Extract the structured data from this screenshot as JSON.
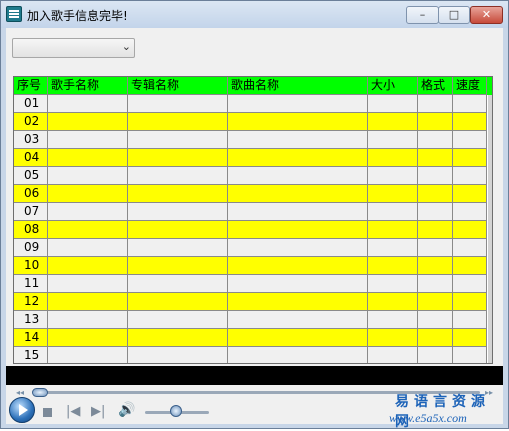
{
  "window": {
    "title": "加入歌手信息完毕!",
    "min_glyph": "–",
    "max_glyph": "□",
    "close_glyph": "✕"
  },
  "combo": {
    "value": "",
    "arrow": "⌄"
  },
  "table": {
    "columns": [
      "序号",
      "歌手名称",
      "专辑名称",
      "歌曲名称",
      "大小",
      "格式",
      "速度"
    ],
    "rows": [
      "01",
      "02",
      "03",
      "04",
      "05",
      "06",
      "07",
      "08",
      "09",
      "10",
      "11",
      "12",
      "13",
      "14",
      "15"
    ],
    "stripe_color": "#ffff00",
    "header_color": "#00ff00"
  },
  "player": {
    "seek_prev": "◂◂",
    "seek_next": "▸▸",
    "prev_glyph": "|◀",
    "next_glyph": "▶|",
    "volume_glyph": "🔊"
  },
  "watermark": {
    "cn": "易语言资源网",
    "url": "www.e5a5x.com"
  }
}
